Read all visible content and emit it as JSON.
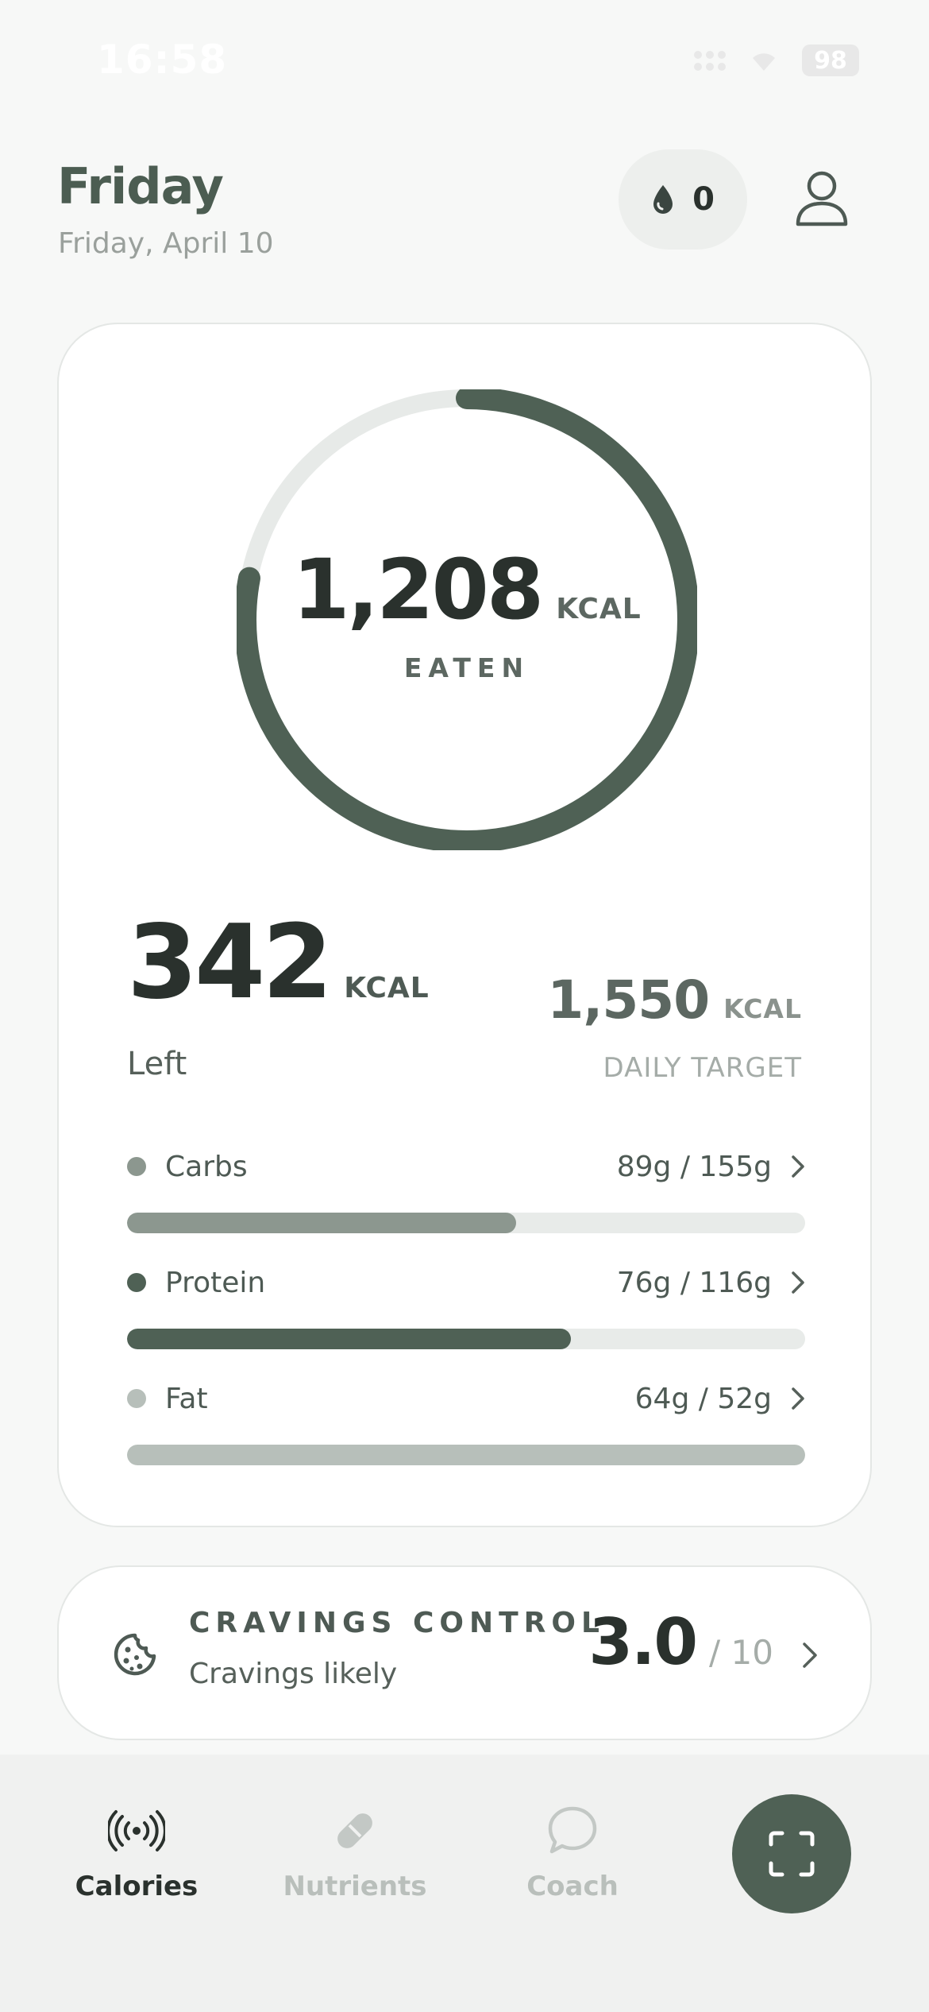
{
  "status_bar": {
    "time": "16:58",
    "battery": "98"
  },
  "header": {
    "day": "Friday",
    "date": "Friday, April 10",
    "streak_count": "0"
  },
  "summary": {
    "eaten_value": "1,208",
    "eaten_unit": "KCAL",
    "eaten_label": "EATEN",
    "left_value": "342",
    "left_unit": "KCAL",
    "left_label": "Left",
    "target_value": "1,550",
    "target_unit": "KCAL",
    "target_label": "DAILY TARGET",
    "ring_progress": 0.78
  },
  "macros": [
    {
      "name": "Carbs",
      "value": "89g / 155g",
      "progress": 0.574,
      "color": "#8c978f"
    },
    {
      "name": "Protein",
      "value": "76g / 116g",
      "progress": 0.655,
      "color": "#4f6155"
    },
    {
      "name": "Fat",
      "value": "64g / 52g",
      "progress": 1.0,
      "color": "#b7bfba"
    }
  ],
  "cravings": {
    "title": "CRAVINGS CONTROL",
    "subtitle": "Cravings likely",
    "score": "3.0",
    "max": "/ 10"
  },
  "tabs": {
    "calories": "Calories",
    "nutrients": "Nutrients",
    "coach": "Coach"
  },
  "colors": {
    "accent": "#4f6155",
    "ring_track": "#e7eae8"
  }
}
